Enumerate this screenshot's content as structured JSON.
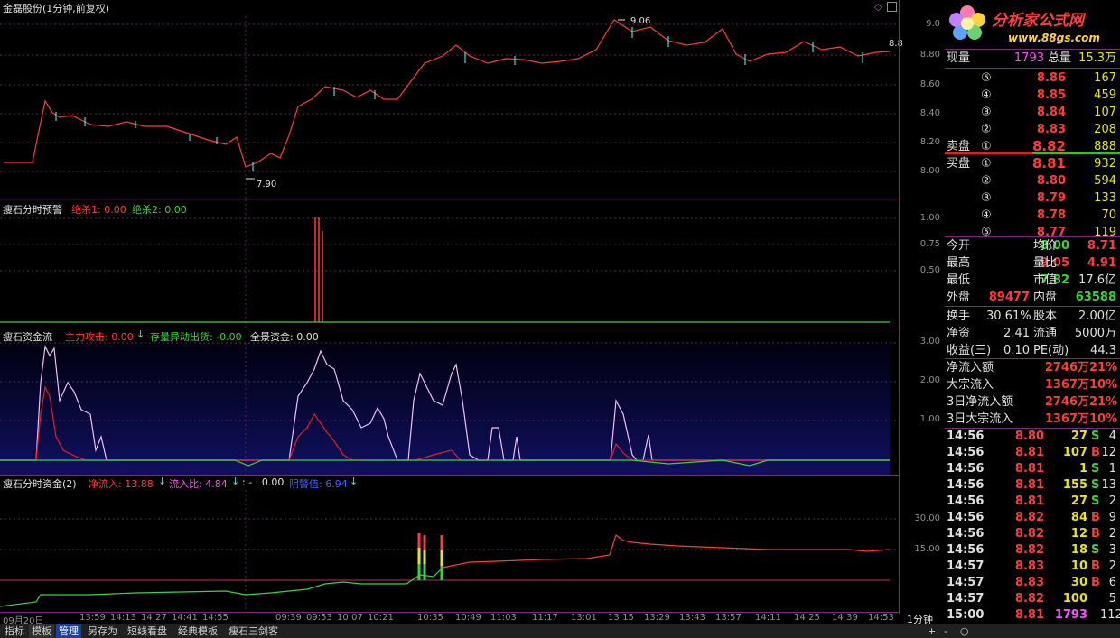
{
  "window": {
    "title": "金磊股份(1分钟,前复权)"
  },
  "panel1": {
    "axis": [
      "9.0",
      "8.80",
      "8.60",
      "8.40",
      "8.20",
      "8.00"
    ],
    "label_high": "9.06",
    "label_low": "7.90",
    "label_right": "8.8"
  },
  "panel2": {
    "title": "瘦石分时预警",
    "ind1": "绝杀1: 0.00",
    "ind2": "绝杀2: 0.00",
    "axis": [
      "1.00",
      "0.75",
      "0.50"
    ]
  },
  "panel3": {
    "title": "瘦石资金流",
    "ind1": "主力攻击: 0.00",
    "ind2": "存量异动出货: -0.00",
    "ind3": "全景资金: 0.00",
    "axis": [
      "3.00",
      "2.00",
      "1.00"
    ]
  },
  "panel4": {
    "title": "瘦石分时资金(2)",
    "ind1": "净流入: 13.88",
    "ind2": "流入比: 4.84",
    "ind3": ": - : 0.00",
    "ind4": "阴警值: 6.94",
    "axis": [
      "30.00",
      "15.00"
    ]
  },
  "time_axis": [
    "09月20日",
    "13:59",
    "14:13",
    "14:27",
    "14:41",
    "14:55",
    "09:39",
    "09:53",
    "10:07",
    "10:21",
    "10:35",
    "10:49",
    "11:03",
    "11:17",
    "13:01",
    "13:15",
    "13:29",
    "13:43",
    "13:57",
    "14:11",
    "14:25",
    "14:39",
    "14:53"
  ],
  "period_label": "1分钟",
  "logo": {
    "name": "分析家公式网",
    "url": "www.88gs.com"
  },
  "quote": {
    "current_vol_label": "现量",
    "current_vol": "1793",
    "total_vol_label": "总量",
    "total_vol": "15.3万",
    "asks": [
      {
        "level": "⑤",
        "price": "8.86",
        "vol": "167"
      },
      {
        "level": "④",
        "price": "8.85",
        "vol": "459"
      },
      {
        "level": "③",
        "price": "8.84",
        "vol": "107"
      },
      {
        "level": "②",
        "price": "8.83",
        "vol": "208"
      },
      {
        "level": "①",
        "price": "8.82",
        "vol": "888"
      }
    ],
    "ask_label": "卖盘",
    "bid_label": "买盘",
    "bids": [
      {
        "level": "①",
        "price": "8.81",
        "vol": "932"
      },
      {
        "level": "②",
        "price": "8.80",
        "vol": "594"
      },
      {
        "level": "③",
        "price": "8.79",
        "vol": "133"
      },
      {
        "level": "④",
        "price": "8.78",
        "vol": "70"
      },
      {
        "level": "⑤",
        "price": "8.77",
        "vol": "119"
      }
    ],
    "stats": [
      {
        "l1": "今开",
        "v1": "8.00",
        "l2": "均价",
        "v2": "8.71"
      },
      {
        "l1": "最高",
        "v1": "9.05",
        "l2": "量比",
        "v2": "4.91"
      },
      {
        "l1": "最低",
        "v1": "7.82",
        "l2": "市值",
        "v2": "17.6亿"
      },
      {
        "l1": "外盘",
        "v1": "89477",
        "l2": "内盘",
        "v2": "63588"
      }
    ],
    "stats2": [
      {
        "l1": "换手",
        "v1": "30.61%",
        "l2": "股本",
        "v2": "2.00亿"
      },
      {
        "l1": "净资",
        "v1": "2.41",
        "l2": "流通",
        "v2": "5000万"
      },
      {
        "l1": "收益(三)",
        "v1": "0.10",
        "l2": "PE(动)",
        "v2": "44.3"
      }
    ],
    "flows": [
      {
        "label": "净流入额",
        "value": "2746万",
        "pct": "21%"
      },
      {
        "label": "大宗流入",
        "value": "1367万",
        "pct": "10%"
      },
      {
        "label": "3日净流入额",
        "value": "2746万",
        "pct": "21%"
      },
      {
        "label": "3日大宗流入",
        "value": "1367万",
        "pct": "10%"
      }
    ],
    "ticks": [
      {
        "t": "14:56",
        "p": "8.80",
        "v": "27",
        "s": "S",
        "n": "4"
      },
      {
        "t": "14:56",
        "p": "8.81",
        "v": "107",
        "s": "B",
        "n": "12"
      },
      {
        "t": "14:56",
        "p": "8.81",
        "v": "1",
        "s": "S",
        "n": "1"
      },
      {
        "t": "14:56",
        "p": "8.81",
        "v": "155",
        "s": "S",
        "n": "13"
      },
      {
        "t": "14:56",
        "p": "8.81",
        "v": "27",
        "s": "S",
        "n": "2"
      },
      {
        "t": "14:56",
        "p": "8.82",
        "v": "84",
        "s": "B",
        "n": "9"
      },
      {
        "t": "14:56",
        "p": "8.82",
        "v": "12",
        "s": "B",
        "n": "2"
      },
      {
        "t": "14:56",
        "p": "8.82",
        "v": "18",
        "s": "S",
        "n": "3"
      },
      {
        "t": "14:57",
        "p": "8.83",
        "v": "10",
        "s": "B",
        "n": "2"
      },
      {
        "t": "14:57",
        "p": "8.83",
        "v": "30",
        "s": "B",
        "n": "6"
      },
      {
        "t": "14:57",
        "p": "8.82",
        "v": "100",
        "s": "",
        "n": "5"
      },
      {
        "t": "15:00",
        "p": "8.81",
        "v": "1793",
        "s": "",
        "n": "112"
      }
    ]
  },
  "bottom_tabs": [
    "指标",
    "模板",
    "管理",
    "另存为",
    "短线看盘",
    "经典模板",
    "瘦石三剑客"
  ],
  "bottom_right": [
    "+",
    "-",
    "○"
  ]
}
